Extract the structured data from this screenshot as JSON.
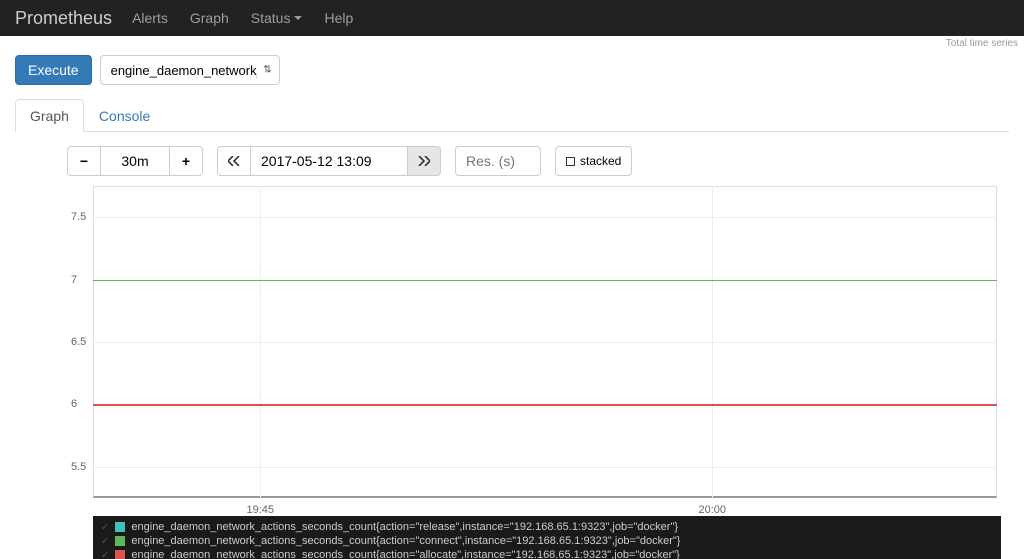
{
  "nav": {
    "brand": "Prometheus",
    "links": [
      "Alerts",
      "Graph",
      "Status",
      "Help"
    ]
  },
  "topinfo": "Total time series",
  "execute_label": "Execute",
  "query_select": "engine_daemon_network_act",
  "tabs": {
    "graph": "Graph",
    "console": "Console"
  },
  "range": {
    "value": "30m"
  },
  "datetime": "2017-05-12 13:09",
  "res_placeholder": "Res. (s)",
  "stacked_label": "stacked",
  "chart_data": {
    "type": "line",
    "ylim": [
      5.25,
      7.75
    ],
    "yticks": [
      5.5,
      6,
      6.5,
      7,
      7.5
    ],
    "xticks": [
      "19:45",
      "20:00"
    ],
    "xtick_positions_pct": [
      18.5,
      68.5
    ],
    "vgrid_positions_pct": [
      18.5,
      68.5
    ],
    "series": [
      {
        "name": "engine_daemon_network_actions_seconds_count{action=\"release\",instance=\"192.168.65.1:9323\",job=\"docker\"}",
        "value": 6,
        "color": "#3fc0c0"
      },
      {
        "name": "engine_daemon_network_actions_seconds_count{action=\"connect\",instance=\"192.168.65.1:9323\",job=\"docker\"}",
        "value": 7,
        "color": "#5cb85c"
      },
      {
        "name": "engine_daemon_network_actions_seconds_count{action=\"allocate\",instance=\"192.168.65.1:9323\",job=\"docker\"}",
        "value": 6,
        "color": "#d9534f"
      }
    ]
  }
}
